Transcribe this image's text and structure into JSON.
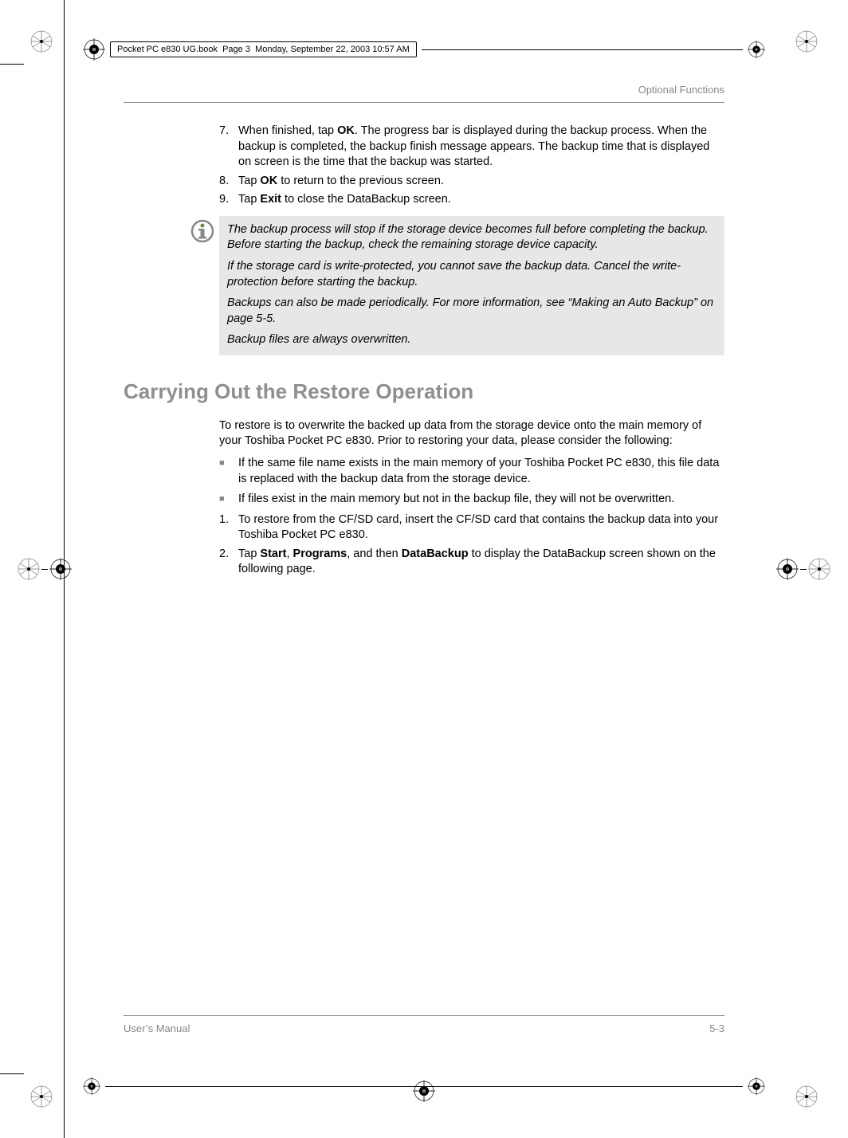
{
  "print_header": {
    "book_title": "Pocket PC e830 UG.book",
    "page_label": "Page 3",
    "date_time": "Monday, September 22, 2003  10:57 AM"
  },
  "running_head": "Optional Functions",
  "steps_top": [
    {
      "num": "7.",
      "pre": "When finished, tap ",
      "bold1": "OK",
      "post": ". The progress bar is displayed during the backup process. When the backup is completed, the backup finish message appears. The backup time that is displayed on screen is the time that the backup was started."
    },
    {
      "num": "8.",
      "pre": "Tap ",
      "bold1": "OK",
      "post": " to return to the previous screen."
    },
    {
      "num": "9.",
      "pre": "Tap ",
      "bold1": "Exit",
      "post": " to close the DataBackup screen."
    }
  ],
  "note": {
    "p1": "The backup process will stop if the storage device becomes full before completing the backup. Before starting the backup, check the remaining storage device capacity.",
    "p2": "If the storage card is write-protected, you cannot save the backup data. Cancel the write-protection before starting the backup.",
    "p3": "Backups can also be made periodically. For more information, see “Making an Auto Backup” on page 5-5.",
    "p4": "Backup files are always overwritten."
  },
  "section_heading": "Carrying Out the Restore Operation",
  "intro_para": "To restore is to overwrite the backed up data from the storage device onto the main memory of your Toshiba Pocket PC e830. Prior to restoring your data, please consider the following:",
  "bullets": [
    "If the same file name exists in the main memory of your Toshiba Pocket PC e830, this file data is replaced with the backup data from the storage device.",
    "If files exist in the main memory but not in the backup file, they will not be overwritten."
  ],
  "steps_bottom": [
    {
      "num": "1.",
      "text": "To restore from the CF/SD card, insert the CF/SD card that contains the backup data into your Toshiba Pocket PC e830."
    },
    {
      "num": "2.",
      "pre": "Tap ",
      "b1": "Start",
      "s1": ", ",
      "b2": "Programs",
      "s2": ", and then ",
      "b3": "DataBackup",
      "post": " to display the DataBackup screen shown on the following page."
    }
  ],
  "footer": {
    "left": "User’s Manual",
    "right": "5-3"
  }
}
